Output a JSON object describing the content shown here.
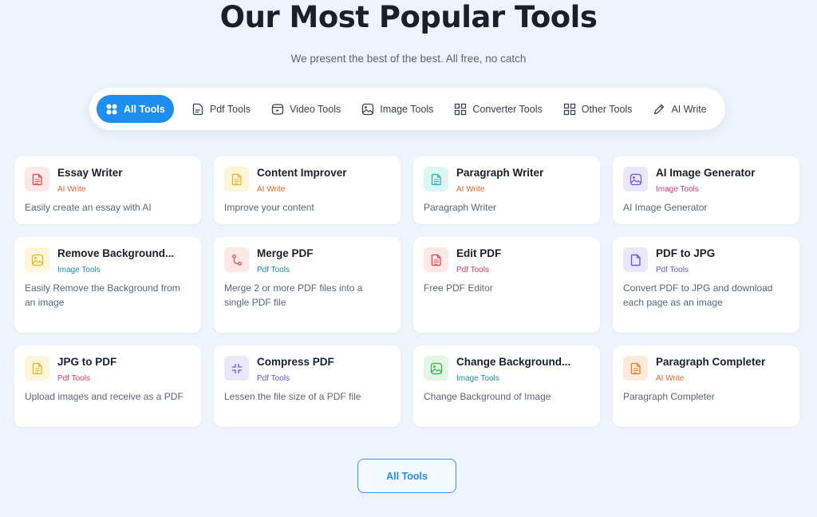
{
  "header": {
    "title": "Our Most Popular Tools",
    "subtitle": "We present the best of the best. All free, no catch"
  },
  "tabs": [
    {
      "label": "All Tools",
      "icon": "grid-dots-icon",
      "active": true
    },
    {
      "label": "Pdf Tools",
      "icon": "pdf-file-icon",
      "active": false
    },
    {
      "label": "Video Tools",
      "icon": "video-icon",
      "active": false
    },
    {
      "label": "Image Tools",
      "icon": "image-icon",
      "active": false
    },
    {
      "label": "Converter Tools",
      "icon": "grid-icon",
      "active": false
    },
    {
      "label": "Other Tools",
      "icon": "grid-icon",
      "active": false
    },
    {
      "label": "AI Write",
      "icon": "pencil-icon",
      "active": false
    }
  ],
  "tools": [
    {
      "name": "Essay Writer",
      "category": "AI Write",
      "description": "Easily create an essay with AI",
      "icon": "document-icon",
      "icon_color": "#e04848",
      "icon_bg": "#fde7e7"
    },
    {
      "name": "Content Improver",
      "category": "AI Write",
      "description": "Improve your content",
      "icon": "document-icon",
      "icon_color": "#e6b52a",
      "icon_bg": "#fdf5d9"
    },
    {
      "name": "Paragraph Writer",
      "category": "AI Write",
      "description": "Paragraph Writer",
      "icon": "document-icon",
      "icon_color": "#19b8b0",
      "icon_bg": "#dcf6f4"
    },
    {
      "name": "AI Image Generator",
      "category": "Image Tools",
      "description": "AI Image Generator",
      "icon": "image-icon",
      "icon_color": "#6a5ad8",
      "icon_bg": "#ebe7fb"
    },
    {
      "name": "Remove Background...",
      "category": "Image Tools",
      "description": "Easily Remove the Background from an image",
      "icon": "image-icon",
      "icon_color": "#e6b52a",
      "icon_bg": "#fdf5d9"
    },
    {
      "name": "Merge PDF",
      "category": "Pdf Tools",
      "description": "Merge 2 or more PDF files into a single PDF file",
      "icon": "merge-icon",
      "icon_color": "#e04848",
      "icon_bg": "#fde7e7"
    },
    {
      "name": "Edit PDF",
      "category": "Pdf Tools",
      "description": "Free PDF Editor",
      "icon": "document-icon",
      "icon_color": "#e04848",
      "icon_bg": "#fde7e7"
    },
    {
      "name": "PDF to JPG",
      "category": "Pdf Tools",
      "description": "Convert PDF to JPG and download each page as an image",
      "icon": "file-icon",
      "icon_color": "#6a5ad8",
      "icon_bg": "#ebe7fb"
    },
    {
      "name": "JPG to PDF",
      "category": "Pdf Tools",
      "description": "Upload images and receive as a PDF",
      "icon": "document-icon",
      "icon_color": "#e6b52a",
      "icon_bg": "#fdf5d9"
    },
    {
      "name": "Compress PDF",
      "category": "Pdf Tools",
      "description": "Lessen the file size of a PDF file",
      "icon": "compress-icon",
      "icon_color": "#6a5ad8",
      "icon_bg": "#ebe7fb"
    },
    {
      "name": "Change Background...",
      "category": "Image Tools",
      "description": "Change Background of Image",
      "icon": "image-icon",
      "icon_color": "#2fb344",
      "icon_bg": "#e3f6e5"
    },
    {
      "name": "Paragraph Completer",
      "category": "AI Write",
      "description": "Paragraph Completer",
      "icon": "document-icon",
      "icon_color": "#f07a2a",
      "icon_bg": "#fdeadb"
    }
  ],
  "footer": {
    "button_label": "All Tools"
  }
}
